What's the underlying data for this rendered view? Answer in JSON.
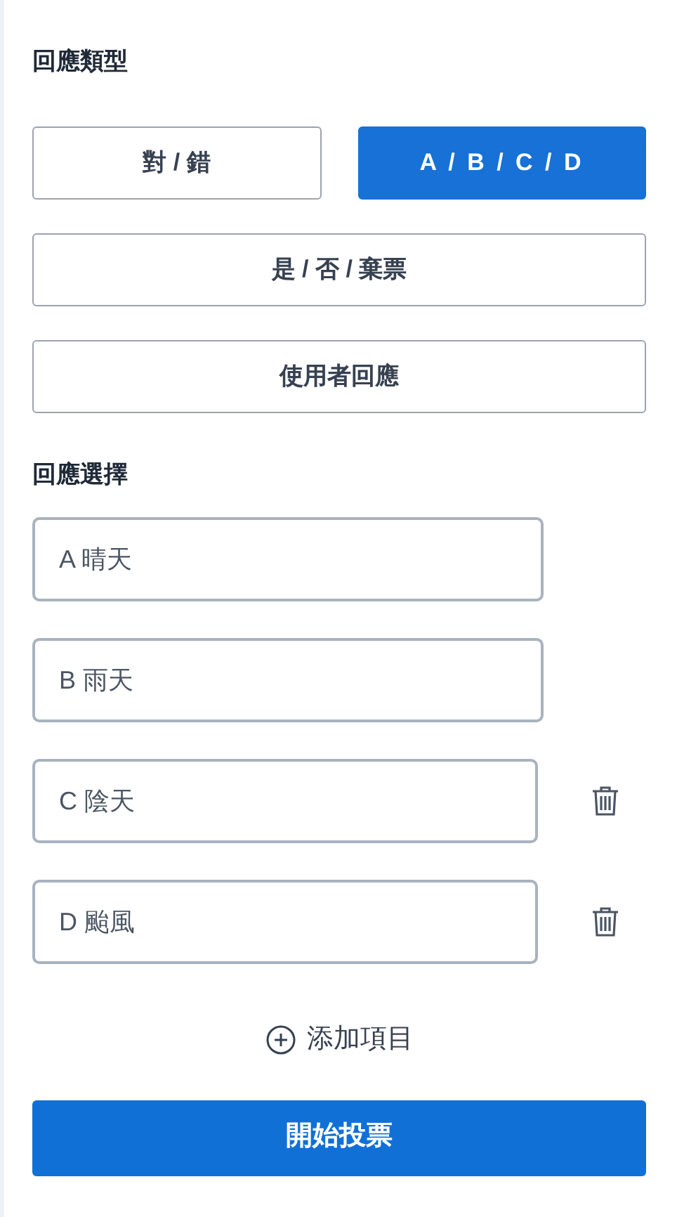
{
  "response_type": {
    "heading": "回應類型",
    "options": [
      {
        "label": "對 / 錯",
        "selected": false
      },
      {
        "label": "A / B / C / D",
        "selected": true
      },
      {
        "label": "是 / 否 / 棄票",
        "selected": false
      },
      {
        "label": "使用者回應",
        "selected": false
      }
    ]
  },
  "choices": {
    "heading": "回應選擇",
    "items": [
      {
        "value": "A 晴天",
        "removable": false
      },
      {
        "value": "B 雨天",
        "removable": false
      },
      {
        "value": "C 陰天",
        "removable": true
      },
      {
        "value": "D 颱風",
        "removable": true
      }
    ]
  },
  "add_item": "添加項目",
  "start_button": "開始投票"
}
